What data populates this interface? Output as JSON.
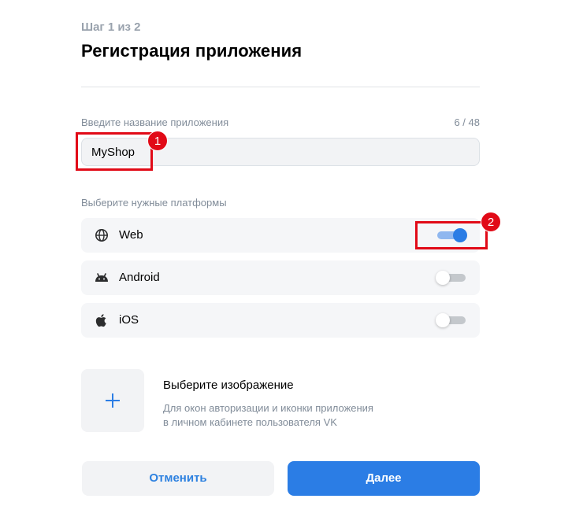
{
  "header": {
    "step": "Шаг 1 из 2",
    "title": "Регистрация приложения"
  },
  "app_name": {
    "label": "Введите название приложения",
    "counter": "6 / 48",
    "value": "MyShop"
  },
  "platforms": {
    "label": "Выберите нужные платформы",
    "items": [
      {
        "name": "Web",
        "icon": "globe-icon",
        "enabled": true
      },
      {
        "name": "Android",
        "icon": "android-icon",
        "enabled": false
      },
      {
        "name": "iOS",
        "icon": "apple-icon",
        "enabled": false
      }
    ]
  },
  "image": {
    "title": "Выберите изображение",
    "desc_line1": "Для окон авторизации и иконки приложения",
    "desc_line2": "в личном кабинете пользователя VK",
    "icon": "plus-icon"
  },
  "buttons": {
    "cancel": "Отменить",
    "next": "Далее"
  },
  "annotations": {
    "marker1": "1",
    "marker2": "2"
  },
  "colors": {
    "accent": "#2b7de5",
    "annotation": "#e10a17"
  }
}
